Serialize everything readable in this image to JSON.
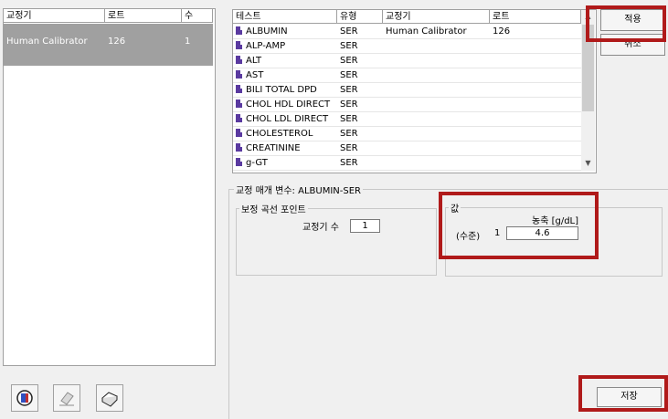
{
  "left_table": {
    "columns": [
      "교정기",
      "로트",
      "수"
    ],
    "rows": [
      {
        "calibrator": "Human Calibrator",
        "lot": "126",
        "count": "1"
      }
    ]
  },
  "test_table": {
    "columns": [
      "테스트",
      "유형",
      "교정기",
      "로트"
    ],
    "rows": [
      {
        "test": "ALBUMIN",
        "type": "SER",
        "calibrator": "Human Calibrator",
        "lot": "126"
      },
      {
        "test": "ALP-AMP",
        "type": "SER",
        "calibrator": "",
        "lot": ""
      },
      {
        "test": "ALT",
        "type": "SER",
        "calibrator": "",
        "lot": ""
      },
      {
        "test": "AST",
        "type": "SER",
        "calibrator": "",
        "lot": ""
      },
      {
        "test": "BILI TOTAL DPD",
        "type": "SER",
        "calibrator": "",
        "lot": ""
      },
      {
        "test": "CHOL HDL DIRECT",
        "type": "SER",
        "calibrator": "",
        "lot": ""
      },
      {
        "test": "CHOL LDL DIRECT",
        "type": "SER",
        "calibrator": "",
        "lot": ""
      },
      {
        "test": "CHOLESTEROL",
        "type": "SER",
        "calibrator": "",
        "lot": ""
      },
      {
        "test": "CREATININE",
        "type": "SER",
        "calibrator": "",
        "lot": ""
      },
      {
        "test": "g-GT",
        "type": "SER",
        "calibrator": "",
        "lot": ""
      }
    ]
  },
  "buttons": {
    "apply": "적용",
    "cancel": "취소",
    "save": "저장"
  },
  "params": {
    "legend": "교정 매개 변수: ALBUMIN-SER",
    "curve_points_legend": "보정 곡선 포인트",
    "calibrator_count_label": "교정기 수",
    "calibrator_count_value": "1",
    "value_legend": "값",
    "concentration_label": "농축 [g/dL]",
    "level_label": "(수준)",
    "level_number": "1",
    "level_value": "4.6"
  },
  "colors": {
    "selected_bg": "#a0a0a0",
    "highlight": "#b01a1a",
    "test_icon": "#5a3aa0"
  },
  "toolbar_icons": [
    "calibration-book-icon",
    "eraser-icon",
    "printer-icon"
  ]
}
